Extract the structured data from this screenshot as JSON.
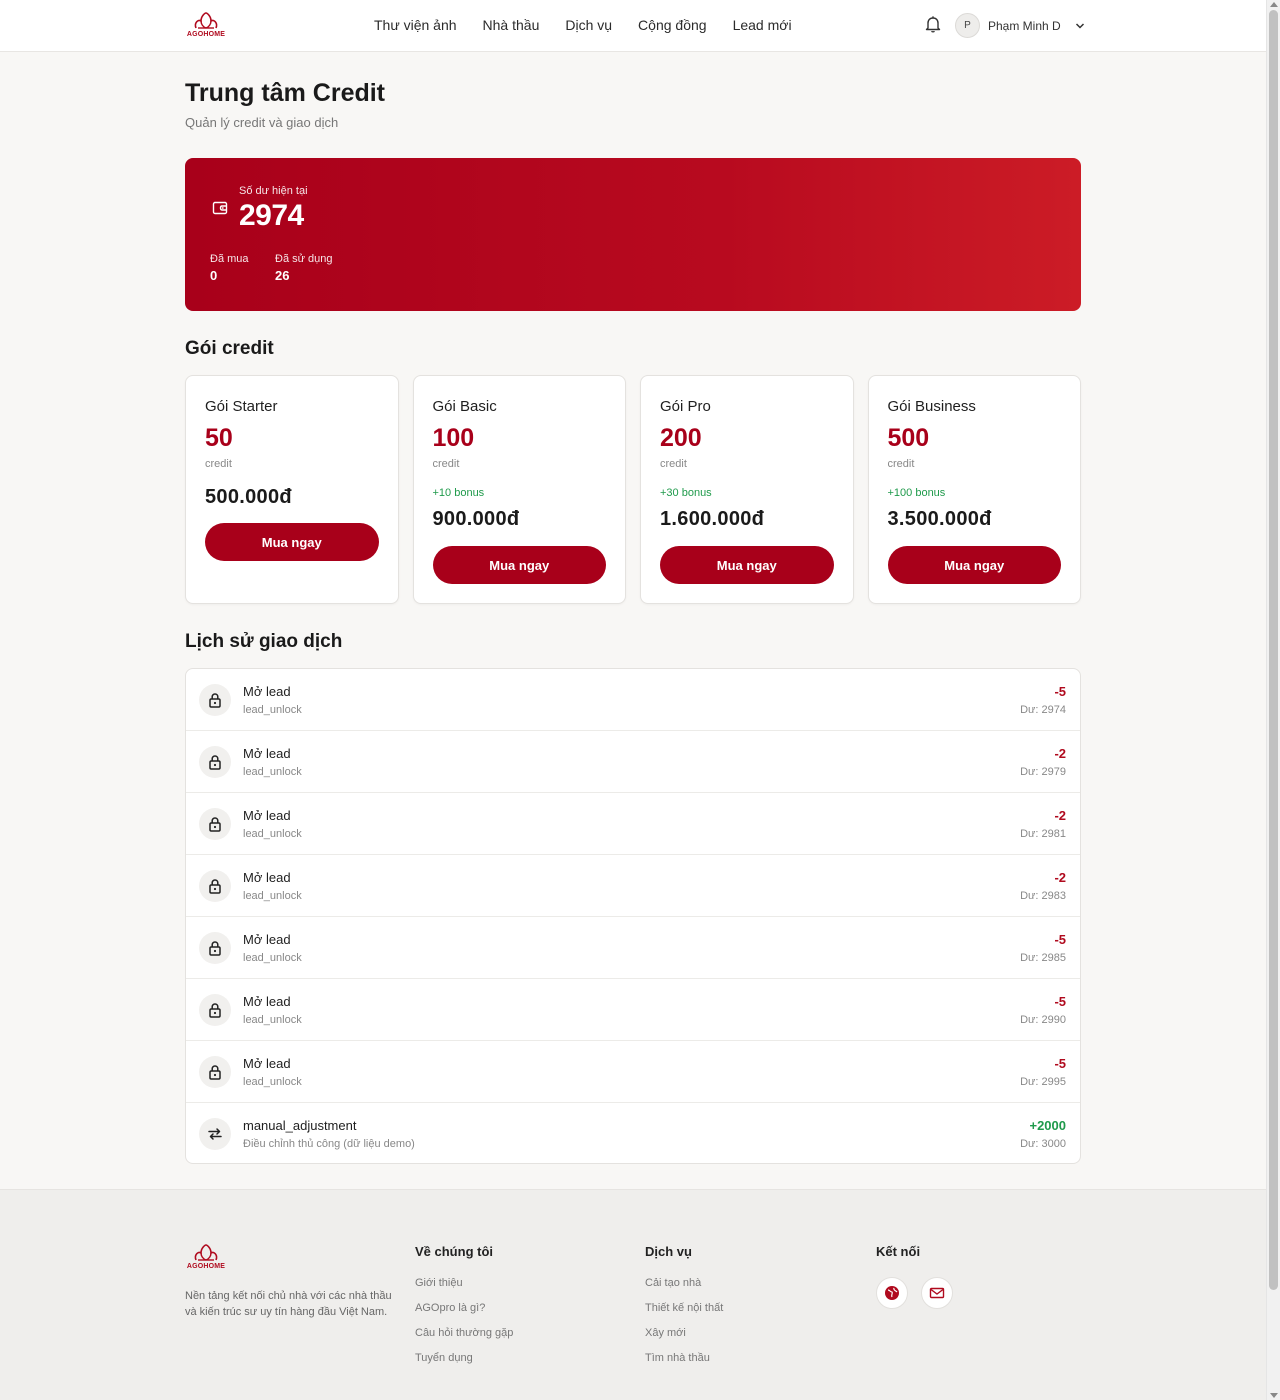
{
  "brand": {
    "name": "AGOHOME",
    "color": "#a8001a"
  },
  "nav": {
    "items": [
      "Thư viện ảnh",
      "Nhà thầu",
      "Dịch vụ",
      "Cộng đồng",
      "Lead mới"
    ]
  },
  "user": {
    "avatar_initial": "P",
    "name": "Phạm Minh D"
  },
  "page": {
    "title": "Trung tâm Credit",
    "subtitle": "Quản lý credit và giao dịch"
  },
  "balance": {
    "label": "Số dư hiện tại",
    "value": "2974",
    "bought_label": "Đã mua",
    "bought_value": "0",
    "used_label": "Đã sử dụng",
    "used_value": "26"
  },
  "packages_section": {
    "title": "Gói credit"
  },
  "packages": [
    {
      "name": "Gói Starter",
      "credit": "50",
      "unit": "credit",
      "bonus": "",
      "price": "500.000đ",
      "button": "Mua ngay"
    },
    {
      "name": "Gói Basic",
      "credit": "100",
      "unit": "credit",
      "bonus": "+10 bonus",
      "price": "900.000đ",
      "button": "Mua ngay"
    },
    {
      "name": "Gói Pro",
      "credit": "200",
      "unit": "credit",
      "bonus": "+30 bonus",
      "price": "1.600.000đ",
      "button": "Mua ngay"
    },
    {
      "name": "Gói Business",
      "credit": "500",
      "unit": "credit",
      "bonus": "+100 bonus",
      "price": "3.500.000đ",
      "button": "Mua ngay"
    }
  ],
  "history_section": {
    "title": "Lịch sử giao dịch"
  },
  "transactions": [
    {
      "icon": "lock-icon",
      "title": "Mở lead",
      "subtitle": "lead_unlock",
      "amount": "-5",
      "balance": "Dư: 2974",
      "type": "neg"
    },
    {
      "icon": "lock-icon",
      "title": "Mở lead",
      "subtitle": "lead_unlock",
      "amount": "-2",
      "balance": "Dư: 2979",
      "type": "neg"
    },
    {
      "icon": "lock-icon",
      "title": "Mở lead",
      "subtitle": "lead_unlock",
      "amount": "-2",
      "balance": "Dư: 2981",
      "type": "neg"
    },
    {
      "icon": "lock-icon",
      "title": "Mở lead",
      "subtitle": "lead_unlock",
      "amount": "-2",
      "balance": "Dư: 2983",
      "type": "neg"
    },
    {
      "icon": "lock-icon",
      "title": "Mở lead",
      "subtitle": "lead_unlock",
      "amount": "-5",
      "balance": "Dư: 2985",
      "type": "neg"
    },
    {
      "icon": "lock-icon",
      "title": "Mở lead",
      "subtitle": "lead_unlock",
      "amount": "-5",
      "balance": "Dư: 2990",
      "type": "neg"
    },
    {
      "icon": "lock-icon",
      "title": "Mở lead",
      "subtitle": "lead_unlock",
      "amount": "-5",
      "balance": "Dư: 2995",
      "type": "neg"
    },
    {
      "icon": "swap-arrows-icon",
      "title": "manual_adjustment",
      "subtitle": "Điều chỉnh thủ công (dữ liệu demo)",
      "amount": "+2000",
      "balance": "Dư: 3000",
      "type": "pos"
    }
  ],
  "footer": {
    "description": "Nền tảng kết nối chủ nhà với các nhà thầu và kiến trúc sư uy tín hàng đầu Việt Nam.",
    "about": {
      "title": "Về chúng tôi",
      "links": [
        "Giới thiệu",
        "AGOpro là gì?",
        "Câu hỏi thường gặp",
        "Tuyển dụng"
      ]
    },
    "services": {
      "title": "Dịch vụ",
      "links": [
        "Cải tạo nhà",
        "Thiết kế nội thất",
        "Xây mới",
        "Tìm nhà thầu"
      ]
    },
    "connect": {
      "title": "Kết nối",
      "icons": [
        "globe-icon",
        "mail-icon"
      ]
    }
  }
}
